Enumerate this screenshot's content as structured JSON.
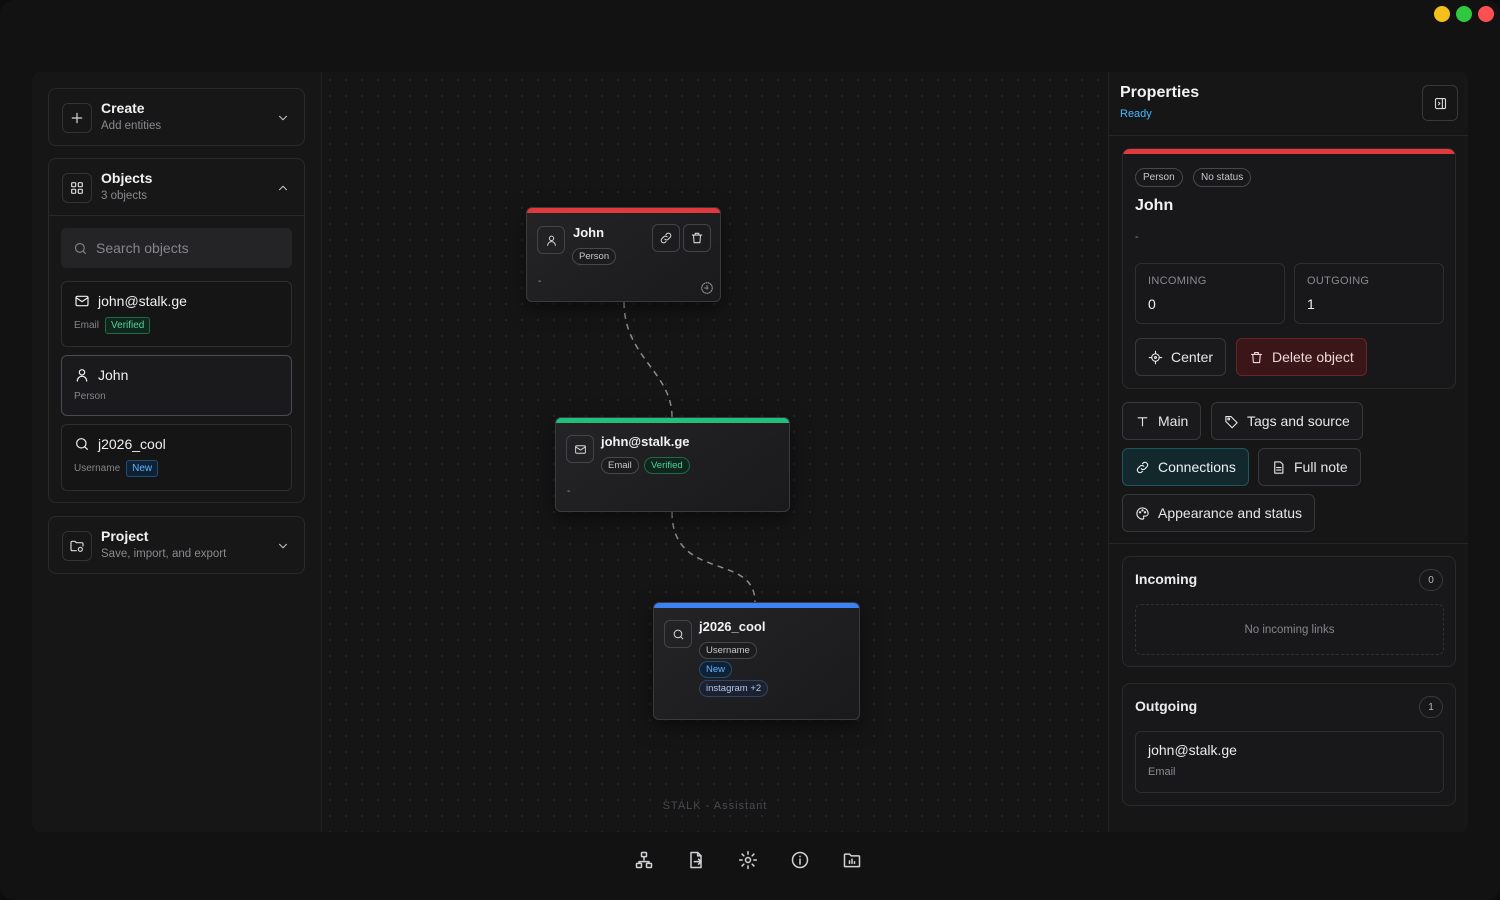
{
  "colors": {
    "person": "#e2393c",
    "email": "#1fbf7e",
    "username": "#3b82f6",
    "accent": "#45b8ff",
    "traffic_yellow": "#f5bf1b",
    "traffic_green": "#2fc840",
    "traffic_red": "#fe4f52"
  },
  "sidebar": {
    "create": {
      "title": "Create",
      "subtitle": "Add entities",
      "icon": "plus-icon"
    },
    "objects": {
      "title": "Objects",
      "subtitle": "3 objects",
      "icon": "grid-icon",
      "search_placeholder": "Search objects",
      "items": [
        {
          "title": "john@stalk.ge",
          "type": "Email",
          "badge": "Verified",
          "icon": "mail-icon"
        },
        {
          "title": "John",
          "type": "Person",
          "icon": "user-icon"
        },
        {
          "title": "j2026_cool",
          "type": "Username",
          "badge": "New",
          "icon": "search-icon"
        }
      ]
    },
    "project": {
      "title": "Project",
      "subtitle": "Save, import, and export",
      "icon": "folder-settings-icon"
    }
  },
  "canvas": {
    "footer": "STALK - Assistant",
    "nodes": [
      {
        "title": "John",
        "type": "Person",
        "desc": "-",
        "icon": "user-icon"
      },
      {
        "title": "john@stalk.ge",
        "type": "Email",
        "badge": "Verified",
        "desc": "-",
        "icon": "mail-icon"
      },
      {
        "title": "j2026_cool",
        "type": "Username",
        "badge": "New",
        "extra": "instagram +2",
        "icon": "search-icon"
      }
    ]
  },
  "properties": {
    "title": "Properties",
    "status": "Ready",
    "entity": {
      "type": "Person",
      "status": "No status",
      "name": "John",
      "desc": "-",
      "incoming_label": "INCOMING",
      "incoming_value": "0",
      "outgoing_label": "OUTGOING",
      "outgoing_value": "1",
      "center_label": "Center",
      "delete_label": "Delete object"
    },
    "tabs": [
      {
        "label": "Main",
        "icon": "text-icon"
      },
      {
        "label": "Tags and source",
        "icon": "tag-icon"
      },
      {
        "label": "Connections",
        "icon": "link-icon",
        "active": true
      },
      {
        "label": "Full note",
        "icon": "file-text-icon"
      },
      {
        "label": "Appearance and status",
        "icon": "palette-icon"
      }
    ],
    "incoming": {
      "title": "Incoming",
      "count": "0",
      "empty": "No incoming links"
    },
    "outgoing": {
      "title": "Outgoing",
      "count": "1",
      "items": [
        {
          "title": "john@stalk.ge",
          "type": "Email"
        }
      ]
    }
  },
  "dock": [
    {
      "name": "graph-icon"
    },
    {
      "name": "file-export-icon"
    },
    {
      "name": "settings-icon"
    },
    {
      "name": "info-icon"
    },
    {
      "name": "chart-folder-icon"
    }
  ]
}
